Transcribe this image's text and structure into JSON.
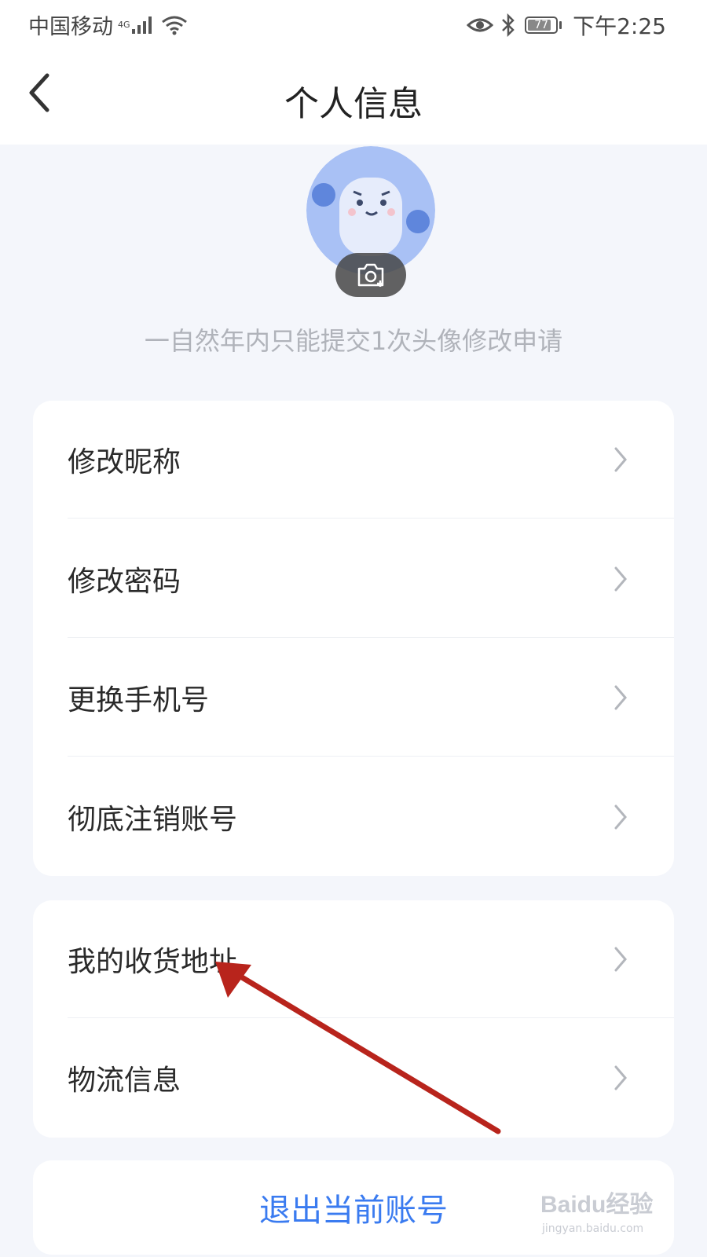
{
  "status_bar": {
    "carrier": "中国移动",
    "network_type": "4G",
    "battery_level": "77",
    "time": "下午2:25"
  },
  "header": {
    "title": "个人信息"
  },
  "avatar": {
    "tip": "一自然年内只能提交1次头像修改申请"
  },
  "menu_group_1": [
    {
      "label": "修改昵称"
    },
    {
      "label": "修改密码"
    },
    {
      "label": "更换手机号"
    },
    {
      "label": "彻底注销账号"
    }
  ],
  "menu_group_2": [
    {
      "label": "我的收货地址"
    },
    {
      "label": "物流信息"
    }
  ],
  "logout": {
    "label": "退出当前账号"
  },
  "watermark": {
    "brand": "Baidu经验",
    "url": "jingyan.baidu.com"
  },
  "colors": {
    "accent": "#3a7bf0",
    "background": "#f4f6fb",
    "annotation_arrow": "#b8241c"
  },
  "icons": [
    "back-arrow-icon",
    "camera-icon",
    "chevron-right-icon",
    "eye-icon",
    "bluetooth-icon",
    "wifi-icon",
    "signal-icon",
    "battery-icon"
  ]
}
